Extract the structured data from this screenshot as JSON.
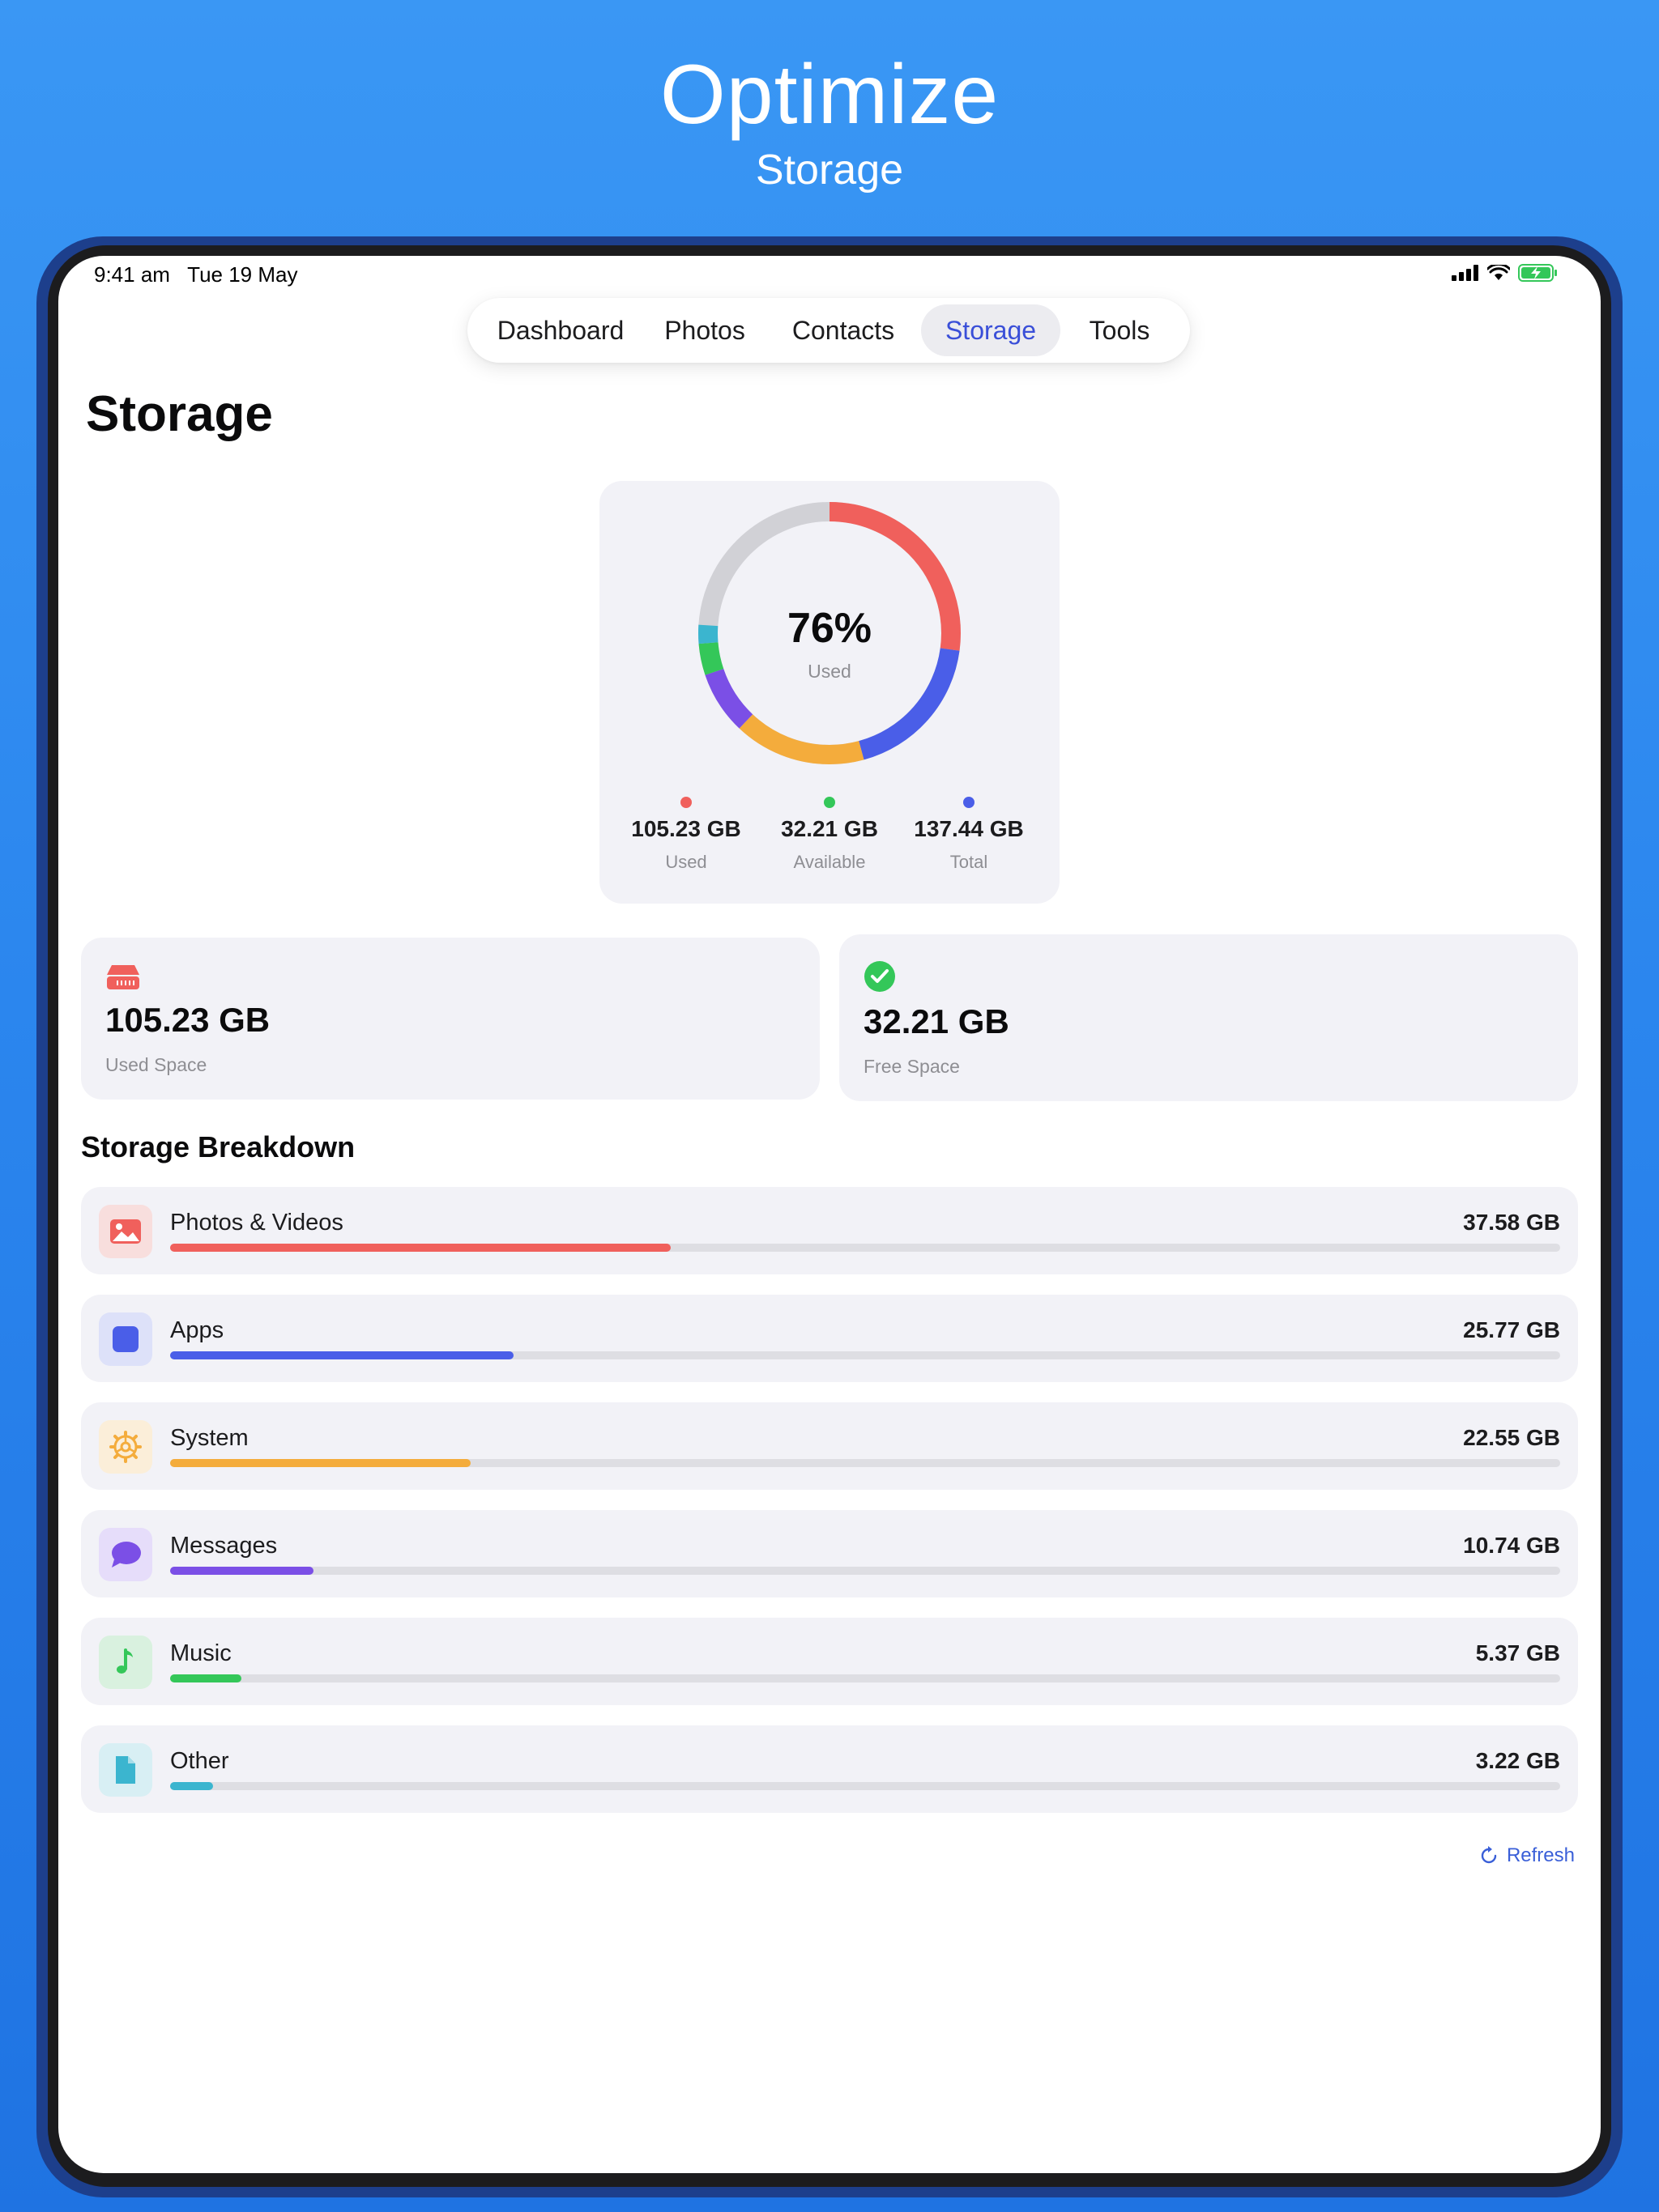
{
  "hero": {
    "title": "Optimize",
    "subtitle": "Storage"
  },
  "status_bar": {
    "time": "9:41 am",
    "date": "Tue 19 May"
  },
  "nav": {
    "tabs": [
      {
        "label": "Dashboard",
        "active": false
      },
      {
        "label": "Photos",
        "active": false
      },
      {
        "label": "Contacts",
        "active": false
      },
      {
        "label": "Storage",
        "active": true
      },
      {
        "label": "Tools",
        "active": false
      }
    ]
  },
  "page": {
    "title": "Storage"
  },
  "summary": {
    "percent_label": "76%",
    "percent_used": 76,
    "center_caption": "Used",
    "legend": [
      {
        "value": "105.23 GB",
        "label": "Used",
        "color": "#f0605c"
      },
      {
        "value": "32.21 GB",
        "label": "Available",
        "color": "#34c759"
      },
      {
        "value": "137.44 GB",
        "label": "Total",
        "color": "#4a5ee8"
      }
    ]
  },
  "cards": {
    "used": {
      "value": "105.23 GB",
      "label": "Used Space",
      "icon": "drive-icon",
      "color": "#f0605c"
    },
    "free": {
      "value": "32.21 GB",
      "label": "Free Space",
      "icon": "checkmark-circle-icon",
      "color": "#34c759"
    }
  },
  "breakdown": {
    "title": "Storage Breakdown",
    "items": [
      {
        "name": "Photos & Videos",
        "size": "37.58 GB",
        "gb": 37.58,
        "color": "#f0605c",
        "icon": "photo-icon"
      },
      {
        "name": "Apps",
        "size": "25.77 GB",
        "gb": 25.77,
        "color": "#4a5ee8",
        "icon": "app-square-icon"
      },
      {
        "name": "System",
        "size": "22.55 GB",
        "gb": 22.55,
        "color": "#f4ac3c",
        "icon": "gear-icon"
      },
      {
        "name": "Messages",
        "size": "10.74 GB",
        "gb": 10.74,
        "color": "#7b4fe6",
        "icon": "message-bubble-icon"
      },
      {
        "name": "Music",
        "size": "5.37 GB",
        "gb": 5.37,
        "color": "#34c759",
        "icon": "music-note-icon"
      },
      {
        "name": "Other",
        "size": "3.22 GB",
        "gb": 3.22,
        "color": "#3bb5cf",
        "icon": "document-icon"
      }
    ]
  },
  "refresh_label": "Refresh"
}
